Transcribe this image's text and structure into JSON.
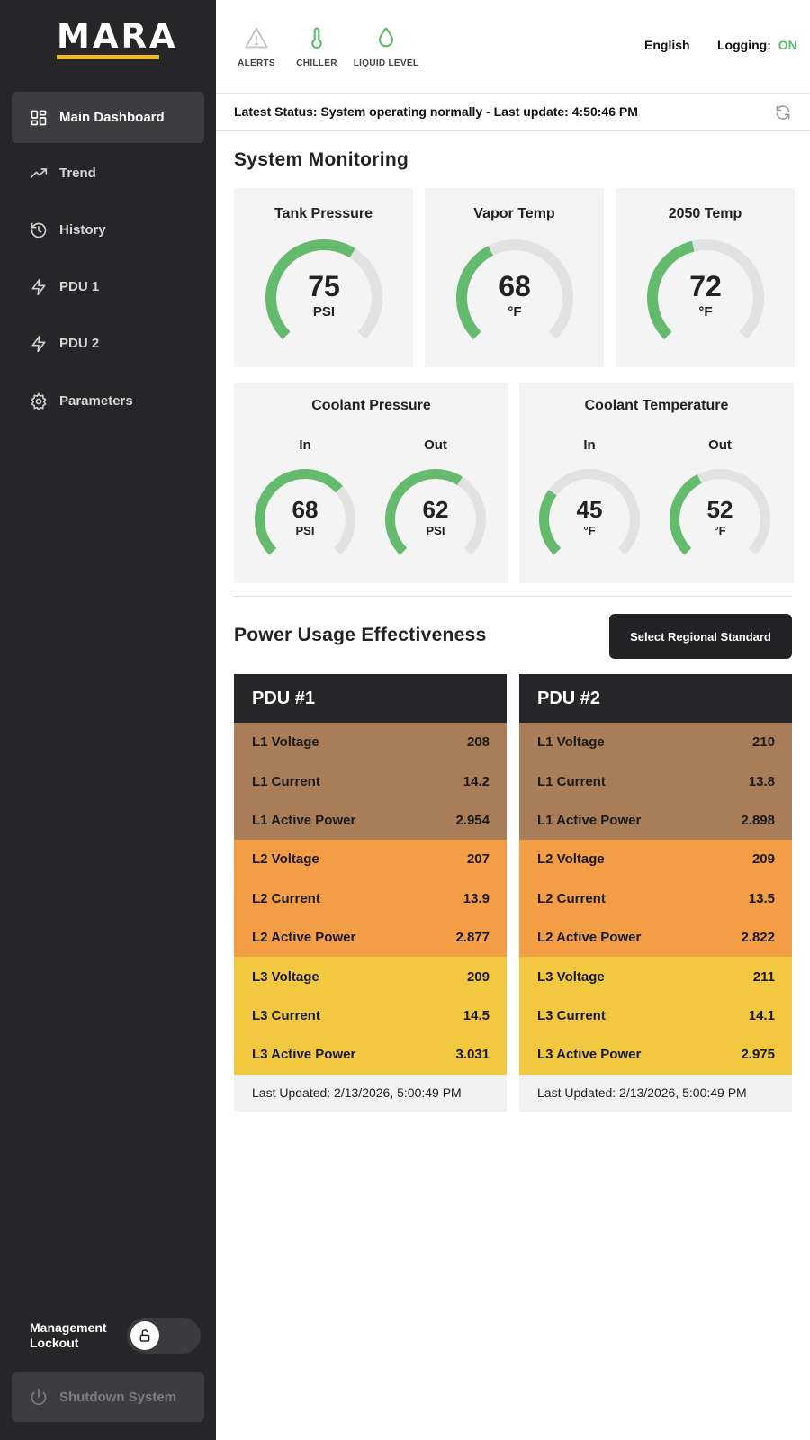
{
  "brand": {
    "logo_text": "MARA",
    "accent": "#f4b820"
  },
  "sidebar": {
    "items": [
      {
        "label": "Main Dashboard",
        "icon": "dashboard-icon",
        "active": true
      },
      {
        "label": "Trend",
        "icon": "trend-icon"
      },
      {
        "label": "History",
        "icon": "history-icon"
      },
      {
        "label": "PDU 1",
        "icon": "lightning-icon"
      },
      {
        "label": "PDU 2",
        "icon": "lightning-icon"
      },
      {
        "label": "Parameters",
        "icon": "gear-icon"
      }
    ],
    "lockout_label": "Management Lockout",
    "lockout_icon": "unlock-icon",
    "shutdown_label": "Shutdown System",
    "shutdown_icon": "power-icon"
  },
  "topbar": {
    "alerts_label": "ALERTS",
    "chiller_label": "CHILLER",
    "liquid_label": "LIQUID LEVEL",
    "language": "English",
    "logging_label": "Logging:",
    "logging_value": "ON"
  },
  "status": {
    "text": "Latest Status: System operating normally - Last update: 4:50:46 PM"
  },
  "monitoring": {
    "title": "System Monitoring",
    "tank_pressure": {
      "title": "Tank Pressure",
      "value": "75",
      "unit": "PSI",
      "fraction": 0.62
    },
    "vapor_temp": {
      "title": "Vapor Temp",
      "value": "68",
      "unit": "°F",
      "fraction": 0.4
    },
    "temp_2050": {
      "title": "2050 Temp",
      "value": "72",
      "unit": "°F",
      "fraction": 0.45
    },
    "coolant_pressure": {
      "title": "Coolant Pressure",
      "in_label": "In",
      "out_label": "Out",
      "in": {
        "value": "68",
        "unit": "PSI",
        "fraction": 0.68
      },
      "out": {
        "value": "62",
        "unit": "PSI",
        "fraction": 0.62
      }
    },
    "coolant_temp": {
      "title": "Coolant Temperature",
      "in_label": "In",
      "out_label": "Out",
      "in": {
        "value": "45",
        "unit": "°F",
        "fraction": 0.3
      },
      "out": {
        "value": "52",
        "unit": "°F",
        "fraction": 0.4
      }
    }
  },
  "pue": {
    "title": "Power Usage Effectiveness",
    "button_label": "Select Regional Standard",
    "pdus": [
      {
        "title": "PDU #1",
        "rows": [
          {
            "label": "L1 Voltage",
            "value": "208"
          },
          {
            "label": "L1 Current",
            "value": "14.2"
          },
          {
            "label": "L1 Active Power",
            "value": "2.954"
          },
          {
            "label": "L2 Voltage",
            "value": "207"
          },
          {
            "label": "L2 Current",
            "value": "13.9"
          },
          {
            "label": "L2 Active Power",
            "value": "2.877"
          },
          {
            "label": "L3 Voltage",
            "value": "209"
          },
          {
            "label": "L3 Current",
            "value": "14.5"
          },
          {
            "label": "L3 Active Power",
            "value": "3.031"
          }
        ],
        "footer": "Last Updated: 2/13/2026, 5:00:49 PM"
      },
      {
        "title": "PDU #2",
        "rows": [
          {
            "label": "L1 Voltage",
            "value": "210"
          },
          {
            "label": "L1 Current",
            "value": "13.8"
          },
          {
            "label": "L1 Active Power",
            "value": "2.898"
          },
          {
            "label": "L2 Voltage",
            "value": "209"
          },
          {
            "label": "L2 Current",
            "value": "13.5"
          },
          {
            "label": "L2 Active Power",
            "value": "2.822"
          },
          {
            "label": "L3 Voltage",
            "value": "211"
          },
          {
            "label": "L3 Current",
            "value": "14.1"
          },
          {
            "label": "L3 Active Power",
            "value": "2.975"
          }
        ],
        "footer": "Last Updated: 2/13/2026, 5:00:49 PM"
      }
    ]
  },
  "colors": {
    "gauge_fill": "#64bb6e",
    "gauge_track": "#e2e2e2",
    "logging_on": "#5cbc67",
    "sidebar_bg": "#262527"
  }
}
